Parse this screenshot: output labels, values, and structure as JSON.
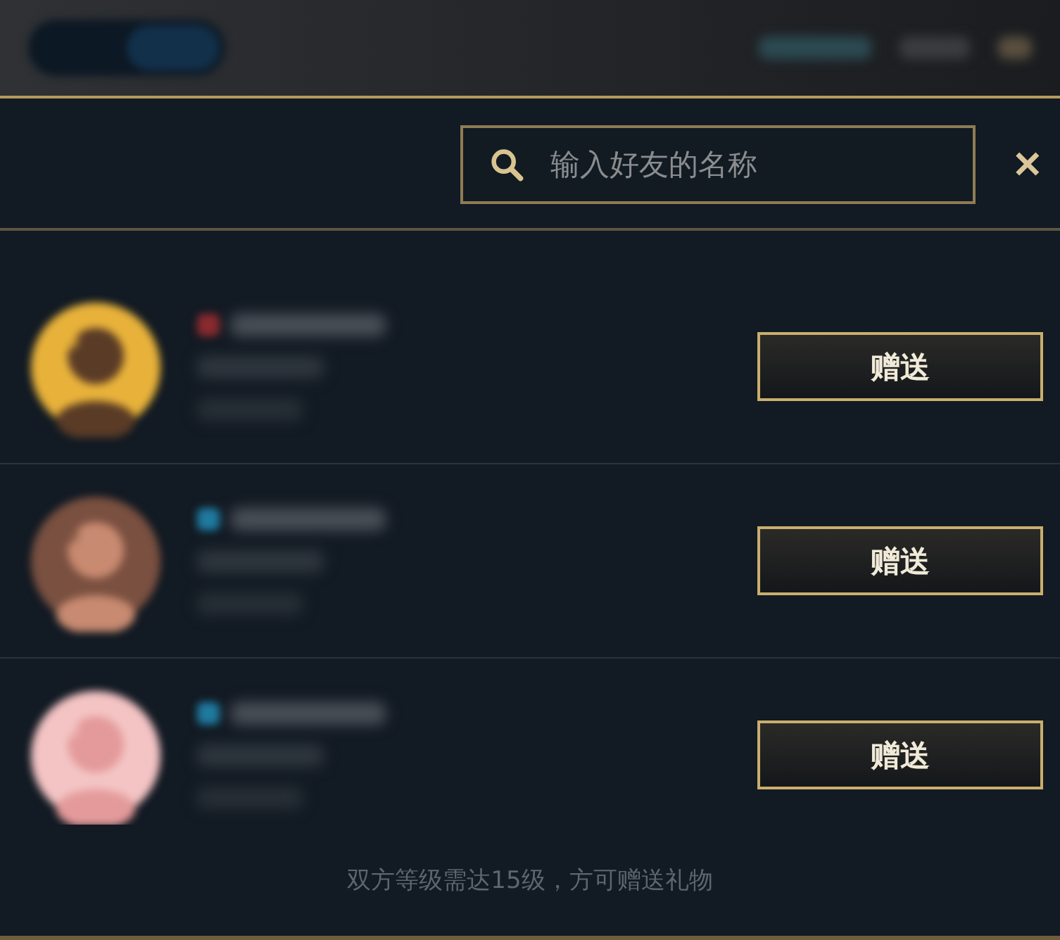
{
  "search": {
    "placeholder": "输入好友的名称",
    "close": "✕"
  },
  "friends": [
    {
      "color": "#8a2a2e",
      "button": "赠送"
    },
    {
      "color": "#1f7aa0",
      "button": "赠送"
    },
    {
      "color": "#1f7aa0",
      "button": "赠送"
    }
  ],
  "footer": "双方等级需达15级，方可赠送礼物"
}
